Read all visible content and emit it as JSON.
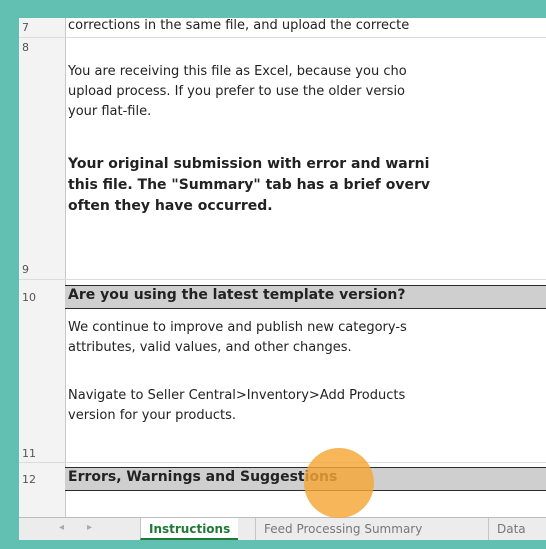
{
  "rows": {
    "r7": {
      "num": "7",
      "text": "corrections in the same file, and upload the correcte"
    },
    "r8": {
      "num": "8",
      "lines": [
        "You are receiving this file as Excel, because you cho",
        "upload process. If you prefer to use the older versio",
        "your flat-file."
      ],
      "bold_lines": [
        "Your original submission with error and warni",
        "this file. The \"Summary\" tab has a brief overv",
        "often they have occurred."
      ]
    },
    "r9": {
      "num": "9"
    },
    "r10": {
      "num": "10",
      "text": "Are you using the latest template version?"
    },
    "r10b": {
      "lines": [
        "We continue to improve and publish new category-s",
        "attributes, valid values, and other changes.",
        "",
        "Navigate to Seller Central>Inventory>Add Products",
        "version for your products."
      ]
    },
    "r11": {
      "num": "11"
    },
    "r12": {
      "num": "12",
      "text": "Errors, Warnings and Suggestions"
    }
  },
  "tabs": [
    "Instructions",
    "Feed Processing Summary",
    "Data"
  ],
  "tab_nav": [
    "◂",
    "▸"
  ],
  "colors": {
    "frame": "#62c0b3",
    "cursor": "#f4a634",
    "active_tab": "#1f7a36"
  }
}
